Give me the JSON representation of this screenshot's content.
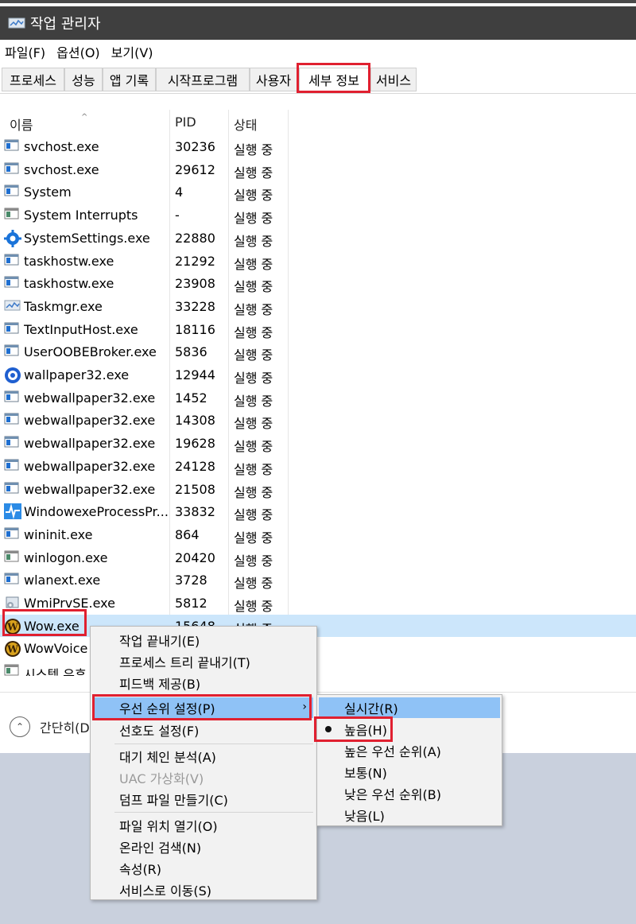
{
  "window": {
    "title": "작업 관리자"
  },
  "menubar": {
    "file": "파일(F)",
    "options": "옵션(O)",
    "view": "보기(V)"
  },
  "tabs": [
    "프로세스",
    "성능",
    "앱 기록",
    "시작프로그램",
    "사용자",
    "세부 정보",
    "서비스"
  ],
  "active_tab": "세부 정보",
  "columns": {
    "name": "이름",
    "pid": "PID",
    "status": "상태"
  },
  "rows": [
    {
      "name": "svchost.exe",
      "pid": "30236",
      "status": "실행 중",
      "icon": "service-app-icon"
    },
    {
      "name": "svchost.exe",
      "pid": "29612",
      "status": "실행 중",
      "icon": "service-app-icon"
    },
    {
      "name": "System",
      "pid": "4",
      "status": "실행 중",
      "icon": "service-app-icon"
    },
    {
      "name": "System Interrupts",
      "pid": "-",
      "status": "실행 중",
      "icon": "window-app-icon"
    },
    {
      "name": "SystemSettings.exe",
      "pid": "22880",
      "status": "실행 중",
      "icon": "settings-gear-icon"
    },
    {
      "name": "taskhostw.exe",
      "pid": "21292",
      "status": "실행 중",
      "icon": "service-app-icon"
    },
    {
      "name": "taskhostw.exe",
      "pid": "23908",
      "status": "실행 중",
      "icon": "service-app-icon"
    },
    {
      "name": "Taskmgr.exe",
      "pid": "33228",
      "status": "실행 중",
      "icon": "task-manager-icon"
    },
    {
      "name": "TextInputHost.exe",
      "pid": "18116",
      "status": "실행 중",
      "icon": "service-app-icon"
    },
    {
      "name": "UserOOBEBroker.exe",
      "pid": "5836",
      "status": "실행 중",
      "icon": "service-app-icon"
    },
    {
      "name": "wallpaper32.exe",
      "pid": "12944",
      "status": "실행 중",
      "icon": "wallpaper-app-icon"
    },
    {
      "name": "webwallpaper32.exe",
      "pid": "1452",
      "status": "실행 중",
      "icon": "service-app-icon"
    },
    {
      "name": "webwallpaper32.exe",
      "pid": "14308",
      "status": "실행 중",
      "icon": "service-app-icon"
    },
    {
      "name": "webwallpaper32.exe",
      "pid": "19628",
      "status": "실행 중",
      "icon": "service-app-icon"
    },
    {
      "name": "webwallpaper32.exe",
      "pid": "24128",
      "status": "실행 중",
      "icon": "service-app-icon"
    },
    {
      "name": "webwallpaper32.exe",
      "pid": "21508",
      "status": "실행 중",
      "icon": "service-app-icon"
    },
    {
      "name": "WindowexeProcessPr...",
      "pid": "33832",
      "status": "실행 중",
      "icon": "pulse-icon"
    },
    {
      "name": "wininit.exe",
      "pid": "864",
      "status": "실행 중",
      "icon": "service-app-icon"
    },
    {
      "name": "winlogon.exe",
      "pid": "20420",
      "status": "실행 중",
      "icon": "window-app-icon"
    },
    {
      "name": "wlanext.exe",
      "pid": "3728",
      "status": "실행 중",
      "icon": "service-app-icon"
    },
    {
      "name": "WmiPrvSE.exe",
      "pid": "5812",
      "status": "실행 중",
      "icon": "wmi-gear-icon"
    },
    {
      "name": "Wow.exe",
      "pid": "15648",
      "status": "실행 중",
      "icon": "wow-icon",
      "selected": true
    },
    {
      "name": "WowVoice",
      "pid": "",
      "status": "",
      "icon": "wow-icon"
    },
    {
      "name": "시스템 유휴",
      "pid": "",
      "status": "",
      "icon": "window-app-icon"
    }
  ],
  "footer": {
    "fewer_details": "간단히(D)"
  },
  "context_menu": {
    "end_task": "작업 끝내기(E)",
    "end_tree": "프로세스 트리 끝내기(T)",
    "feedback": "피드백 제공(B)",
    "priority": "우선 순위 설정(P)",
    "affinity": "선호도 설정(F)",
    "wait_chain": "대기 체인 분석(A)",
    "uac": "UAC 가상화(V)",
    "dump": "덤프 파일 만들기(C)",
    "open_location": "파일 위치 열기(O)",
    "search_online": "온라인 검색(N)",
    "properties": "속성(R)",
    "go_services": "서비스로 이동(S)"
  },
  "priority_menu": {
    "realtime": "실시간(R)",
    "high": "높음(H)",
    "above_normal": "높은 우선 순위(A)",
    "normal": "보통(N)",
    "below_normal": "낮은 우선 순위(B)",
    "low": "낮음(L)",
    "checked": "높음(H)"
  },
  "colors": {
    "highlight": "#cce6fb",
    "menu_hot": "#8fc2f6",
    "annotation_red": "#e02030"
  }
}
